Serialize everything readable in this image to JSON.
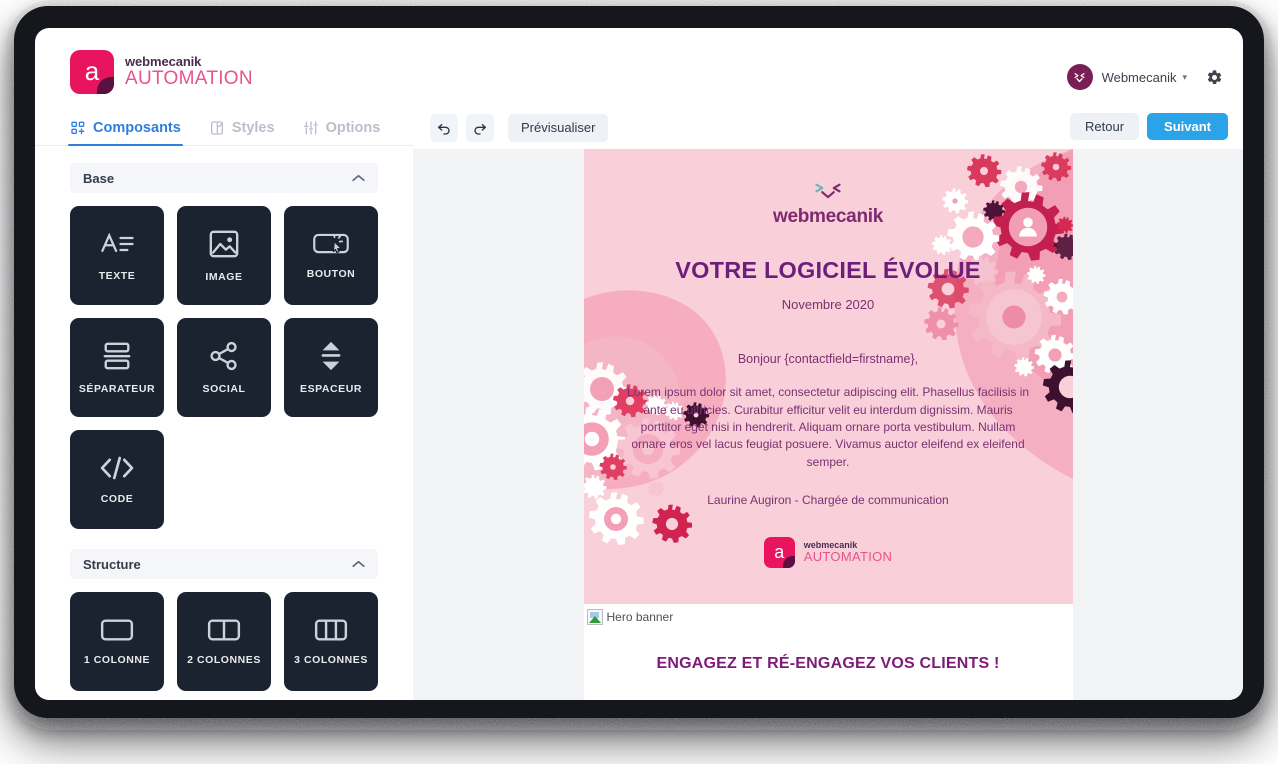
{
  "brand": {
    "mark_letter": "a",
    "name_top": "webmecanik",
    "name_bottom": "AUTOMATION"
  },
  "account": {
    "name": "Webmecanik",
    "caret": "▾",
    "avatar_icon": "webmecanik-x-logo",
    "settings_icon": "gear-icon"
  },
  "tabs": [
    {
      "label": "Composants",
      "icon": "components-grid-icon",
      "active": true
    },
    {
      "label": "Styles",
      "icon": "palette-icon",
      "active": false
    },
    {
      "label": "Options",
      "icon": "sliders-icon",
      "active": false
    }
  ],
  "sections": [
    {
      "title": "Base",
      "collapse_icon": "chevron-up-icon",
      "tiles": [
        {
          "label": "TEXTE",
          "icon": "text-icon"
        },
        {
          "label": "IMAGE",
          "icon": "image-icon"
        },
        {
          "label": "BOUTON",
          "icon": "button-cursor-icon"
        },
        {
          "label": "SÉPARATEUR",
          "icon": "separator-icon"
        },
        {
          "label": "SOCIAL",
          "icon": "share-icon"
        },
        {
          "label": "ESPACEUR",
          "icon": "spacer-arrows-icon"
        },
        {
          "label": "CODE",
          "icon": "code-icon"
        }
      ]
    },
    {
      "title": "Structure",
      "collapse_icon": "chevron-up-icon",
      "tiles": [
        {
          "label": "1 COLONNE",
          "icon": "one-column-icon"
        },
        {
          "label": "2 COLONNES",
          "icon": "two-columns-icon"
        },
        {
          "label": "3 COLONNES",
          "icon": "three-columns-icon"
        }
      ]
    }
  ],
  "toolbar": {
    "undo_icon": "undo-arrow-icon",
    "redo_icon": "redo-arrow-icon",
    "preview_label": "Prévisualiser",
    "back_label": "Retour",
    "next_label": "Suivant"
  },
  "email": {
    "logo_word": "webmecanik",
    "title": "VOTRE LOGICIEL ÉVOLUE",
    "date": "Novembre 2020",
    "greeting": "Bonjour {contactfield=firstname},",
    "body": "Lorem ipsum dolor sit amet, consectetur adipiscing elit. Phasellus facilisis in ante eu ultricies. Curabitur efficitur velit eu interdum dignissim. Mauris porttitor eget nisi in hendrerit. Aliquam ornare porta vestibulum. Nullam ornare eros vel lacus feugiat posuere. Vivamus auctor eleifend ex eleifend semper.",
    "signature": "Laurine Augiron - Chargée de communication",
    "footer_logo": {
      "mark_letter": "a",
      "name_top": "webmecanik",
      "name_bottom": "AUTOMATION"
    },
    "broken_image_alt": "Hero banner",
    "section_heading": "ENGAGEZ ET RÉ-ENGAGEZ VOS CLIENTS !"
  },
  "colors": {
    "brand_pink": "#e8155e",
    "brand_light_pink": "#e8538c",
    "accent_blue": "#2f7fe0",
    "primary_button": "#2aa3e8",
    "tile_dark": "#1b2230",
    "email_pink_bg": "#f9cfd9",
    "email_purple_text": "#7a3170",
    "email_heading_purple": "#6b1f7a",
    "avatar_purple": "#7a1f55"
  }
}
